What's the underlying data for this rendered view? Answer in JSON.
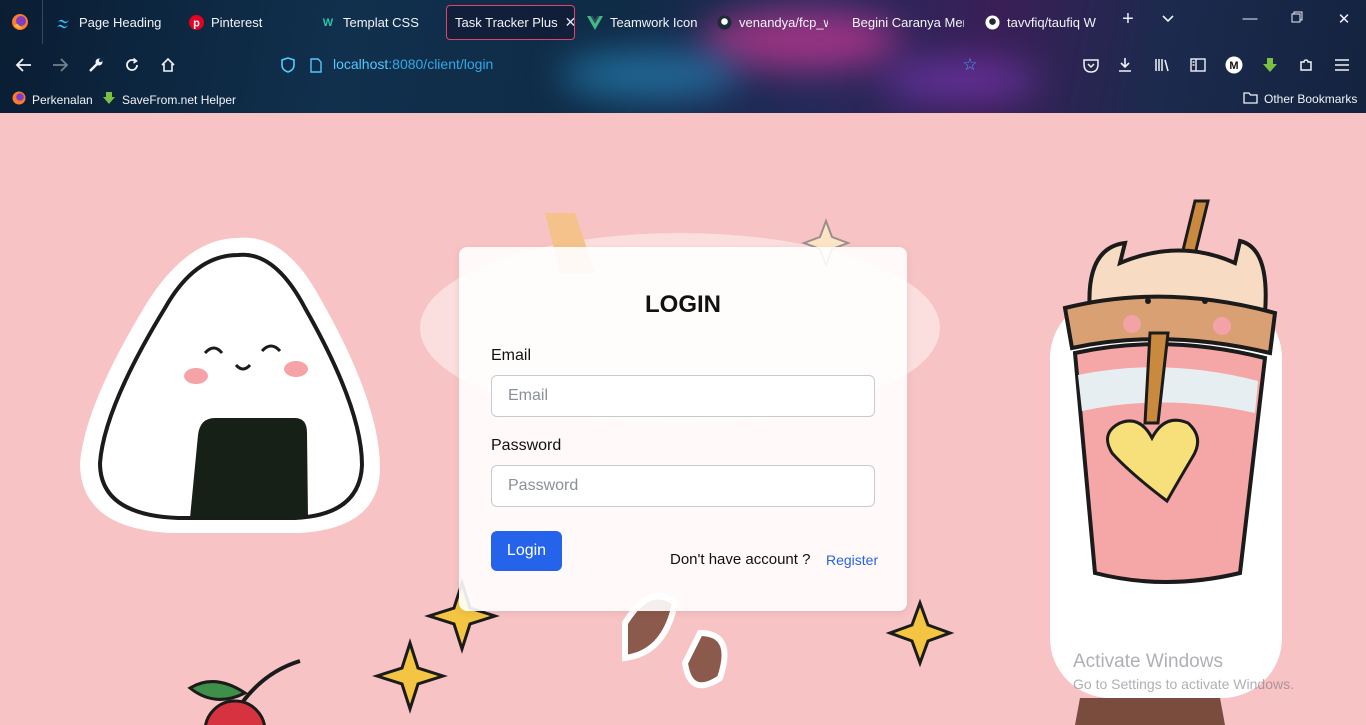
{
  "browser": {
    "tabs": [
      {
        "label": "Page Headings",
        "icon": "tailwind-icon",
        "color": "#38bdf8",
        "active": false
      },
      {
        "label": "Pinterest",
        "icon": "pinterest-icon",
        "color": "#e60023",
        "active": false
      },
      {
        "label": "Templat CSS",
        "icon": "w-icon",
        "color": "#2ec4a5",
        "active": false
      },
      {
        "label": "Task Tracker Plus",
        "icon": "",
        "color": "",
        "active": true
      },
      {
        "label": "Teamwork Icon P",
        "icon": "vue-icon",
        "color": "#42b883",
        "active": false
      },
      {
        "label": "venandya/fcp_w",
        "icon": "github-icon",
        "color": "#ffffff",
        "active": false
      },
      {
        "label": "Begini Caranya Men",
        "icon": "",
        "color": "",
        "active": false
      },
      {
        "label": "tavvfiq/taufiq W",
        "icon": "github-icon",
        "color": "#ffffff",
        "active": false
      }
    ],
    "url": {
      "host": "localhost",
      "rest": ":8080/client/login"
    },
    "bookmarks": [
      {
        "label": "Perkenalan",
        "icon": "firefox-icon"
      },
      {
        "label": "SaveFrom.net Helper",
        "icon": "download-arrow-icon"
      }
    ],
    "other_bookmarks": "Other Bookmarks"
  },
  "login": {
    "title": "LOGIN",
    "email_label": "Email",
    "email_placeholder": "Email",
    "password_label": "Password",
    "password_placeholder": "Password",
    "submit_label": "Login",
    "no_account_text": "Don't have account ?",
    "register_link": "Register"
  },
  "watermark": {
    "title": "Activate Windows",
    "subtitle": "Go to Settings to activate Windows."
  },
  "colors": {
    "page_background": "#f8c3c4",
    "primary": "#2563eb",
    "active_tab_border": "#e0446c"
  }
}
